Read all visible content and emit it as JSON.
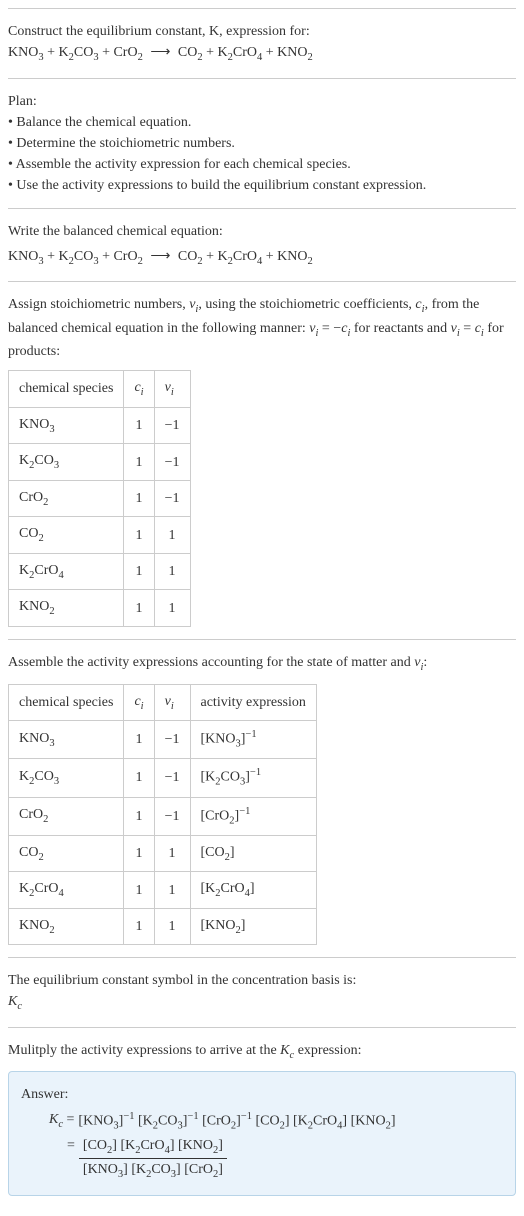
{
  "intro": {
    "line1": "Construct the equilibrium constant, K, expression for:",
    "equation": "KNO₃ + K₂CO₃ + CrO₂  ⟶  CO₂ + K₂CrO₄ + KNO₂"
  },
  "plan": {
    "title": "Plan:",
    "bullets": [
      "• Balance the chemical equation.",
      "• Determine the stoichiometric numbers.",
      "• Assemble the activity expression for each chemical species.",
      "• Use the activity expressions to build the equilibrium constant expression."
    ]
  },
  "balanced": {
    "title": "Write the balanced chemical equation:",
    "equation": "KNO₃ + K₂CO₃ + CrO₂  ⟶  CO₂ + K₂CrO₄ + KNO₂"
  },
  "stoich": {
    "text": "Assign stoichiometric numbers, νᵢ, using the stoichiometric coefficients, cᵢ, from the balanced chemical equation in the following manner: νᵢ = −cᵢ for reactants and νᵢ = cᵢ for products:",
    "table": {
      "headers": [
        "chemical species",
        "cᵢ",
        "νᵢ"
      ],
      "rows": [
        [
          "KNO₃",
          "1",
          "−1"
        ],
        [
          "K₂CO₃",
          "1",
          "−1"
        ],
        [
          "CrO₂",
          "1",
          "−1"
        ],
        [
          "CO₂",
          "1",
          "1"
        ],
        [
          "K₂CrO₄",
          "1",
          "1"
        ],
        [
          "KNO₂",
          "1",
          "1"
        ]
      ]
    }
  },
  "activity": {
    "text": "Assemble the activity expressions accounting for the state of matter and νᵢ:",
    "table": {
      "headers": [
        "chemical species",
        "cᵢ",
        "νᵢ",
        "activity expression"
      ],
      "rows": [
        [
          "KNO₃",
          "1",
          "−1",
          "[KNO₃]⁻¹"
        ],
        [
          "K₂CO₃",
          "1",
          "−1",
          "[K₂CO₃]⁻¹"
        ],
        [
          "CrO₂",
          "1",
          "−1",
          "[CrO₂]⁻¹"
        ],
        [
          "CO₂",
          "1",
          "1",
          "[CO₂]"
        ],
        [
          "K₂CrO₄",
          "1",
          "1",
          "[K₂CrO₄]"
        ],
        [
          "KNO₂",
          "1",
          "1",
          "[KNO₂]"
        ]
      ]
    }
  },
  "symbol": {
    "line1": "The equilibrium constant symbol in the concentration basis is:",
    "line2": "K_c"
  },
  "multiply": {
    "text": "Mulitply the activity expressions to arrive at the K_c expression:"
  },
  "answer": {
    "label": "Answer:",
    "lhs": "K_c =",
    "rhs1": "[KNO₃]⁻¹ [K₂CO₃]⁻¹ [CrO₂]⁻¹ [CO₂] [K₂CrO₄] [KNO₂]",
    "eq2": "=",
    "num": "[CO₂] [K₂CrO₄] [KNO₂]",
    "den": "[KNO₃] [K₂CO₃] [CrO₂]"
  }
}
